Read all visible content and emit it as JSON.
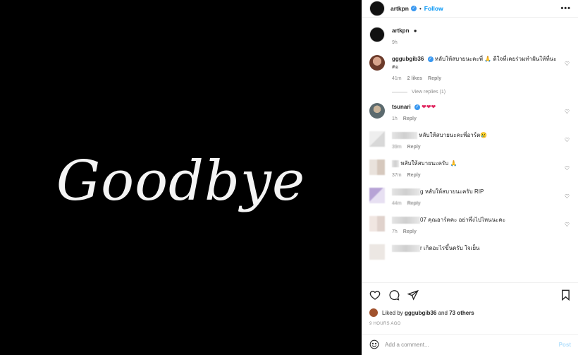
{
  "media": {
    "text": "Goodbye"
  },
  "header": {
    "username": "artkpn",
    "separator": "•",
    "follow_label": "Follow",
    "more": "•••"
  },
  "caption": {
    "username": "artkpn",
    "time": "9h"
  },
  "comments": [
    {
      "username": "gggubgib36",
      "text": "หลับให้สบายนะคะพี่ 🙏 ดีใจที่เคยร่วมทำฝันให้ที่นะคะ",
      "time": "41m",
      "likes": "2 likes",
      "reply": "Reply",
      "view_replies": "View replies (1)"
    },
    {
      "username": "tsunari",
      "text": "❤❤❤",
      "time": "1h",
      "reply": "Reply"
    },
    {
      "text": "หลับให้สบายนะคะพี่อาร์ต😢",
      "time": "39m",
      "reply": "Reply"
    },
    {
      "text": "หลับให้สบายนะครับ 🙏",
      "time": "37m",
      "reply": "Reply"
    },
    {
      "text_prefix": "g",
      "text": "หลับให้สบายนะครับ RIP",
      "time": "44m",
      "reply": "Reply"
    },
    {
      "text_prefix": "07",
      "text": "คุณอาร์ตคะ อย่าพึ่งไปไหนนะคะ",
      "time": "7h",
      "reply": "Reply"
    },
    {
      "text_prefix": "r",
      "text": "เกิดอะไรขึ้นครับ ใจเย็น"
    }
  ],
  "likes": {
    "prefix": "Liked by",
    "user": "gggubgib36",
    "middle": "and",
    "others": "73 others"
  },
  "timestamp": "9 HOURS AGO",
  "add_comment": {
    "placeholder": "Add a comment...",
    "post_label": "Post"
  }
}
